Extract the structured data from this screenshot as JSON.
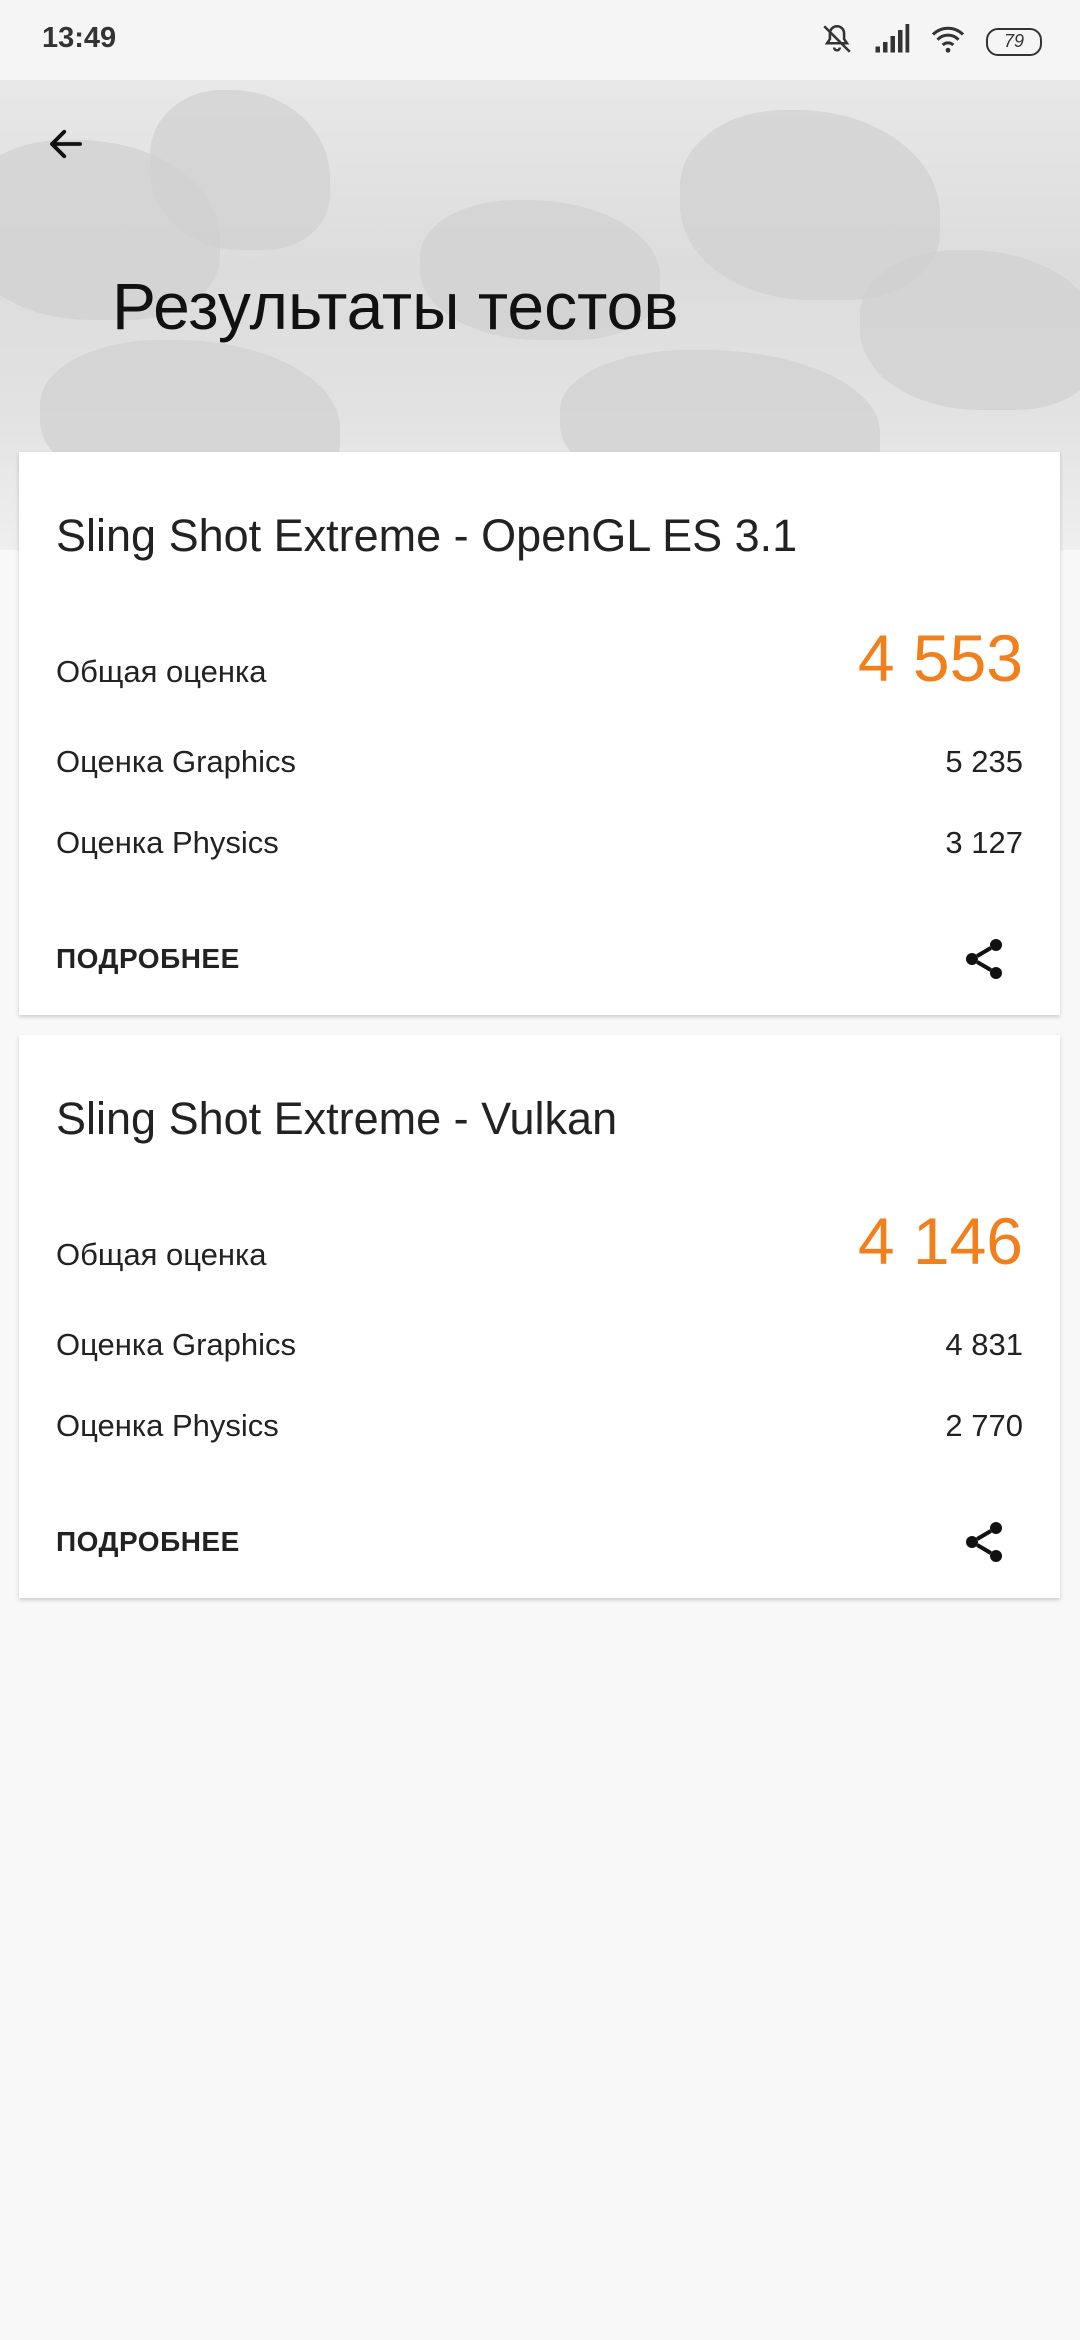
{
  "status_bar": {
    "time": "13:49",
    "battery": "79",
    "icons": [
      "mute-icon",
      "signal-icon",
      "wifi-icon",
      "battery-icon"
    ]
  },
  "header": {
    "title": "Результаты тестов",
    "back_icon": "arrow-left-icon"
  },
  "cards": [
    {
      "title": "Sling Shot Extreme - OpenGL ES 3.1",
      "total_label": "Общая оценка",
      "total_value": "4 553",
      "graphics_label": "Оценка Graphics",
      "graphics_value": "5 235",
      "physics_label": "Оценка Physics",
      "physics_value": "3 127",
      "details_label": "ПОДРОБНЕЕ",
      "share_icon": "share-icon"
    },
    {
      "title": "Sling Shot Extreme - Vulkan",
      "total_label": "Общая оценка",
      "total_value": "4 146",
      "graphics_label": "Оценка Graphics",
      "graphics_value": "4 831",
      "physics_label": "Оценка Physics",
      "physics_value": "2 770",
      "details_label": "ПОДРОБНЕЕ",
      "share_icon": "share-icon"
    }
  ],
  "colors": {
    "accent": "#f07f1c",
    "background": "#f8f8f8",
    "card": "#ffffff"
  }
}
